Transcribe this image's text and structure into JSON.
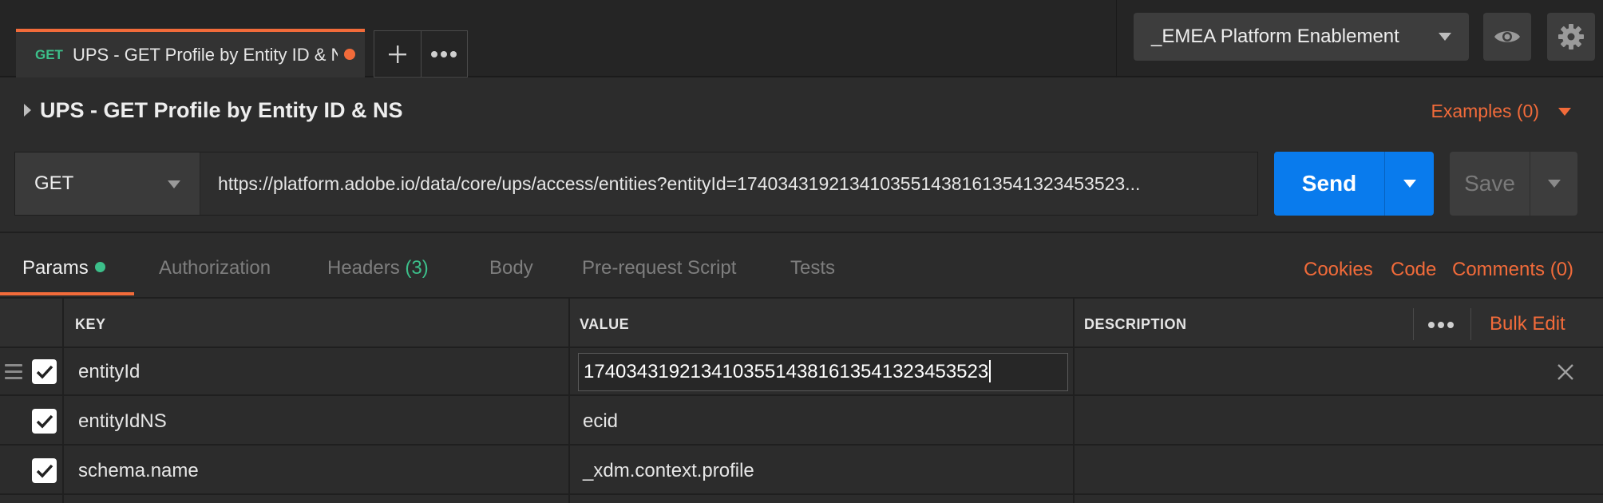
{
  "tabs": [
    {
      "method": "GET",
      "name": "UPS - GET Profile by Entity ID & NS",
      "unsaved": true
    }
  ],
  "tab_actions": {
    "add_icon": "plus-icon",
    "more_icon": "more-horizontal-icon"
  },
  "environment": {
    "selected": "_EMEA Platform Enablement"
  },
  "request": {
    "title": "UPS - GET Profile by Entity ID & NS",
    "examples_label": "Examples (0)",
    "method": "GET",
    "url": "https://platform.adobe.io/data/core/ups/access/entities?entityId=174034319213410355143816135413234535​23...",
    "send_label": "Send",
    "save_label": "Save"
  },
  "subtabs": {
    "params": "Params",
    "authorization": "Authorization",
    "headers": "Headers",
    "headers_count": "(3)",
    "body": "Body",
    "prerequest": "Pre-request Script",
    "tests": "Tests",
    "cookies": "Cookies",
    "code": "Code",
    "comments": "Comments (0)"
  },
  "params_table": {
    "headers": {
      "key": "KEY",
      "value": "VALUE",
      "description": "DESCRIPTION",
      "bulk_edit": "Bulk Edit"
    },
    "rows": [
      {
        "key": "entityId",
        "value": "17403431921341035514381613541323453523",
        "description": "",
        "checked": true
      },
      {
        "key": "entityIdNS",
        "value": "ecid",
        "description": "",
        "checked": true
      },
      {
        "key": "schema.name",
        "value": "_xdm.context.profile",
        "description": "",
        "checked": true
      }
    ]
  },
  "colors": {
    "accent": "#f26b3a",
    "send": "#097bed",
    "method_get": "#3cbf8a",
    "background": "#2c2c2c"
  }
}
